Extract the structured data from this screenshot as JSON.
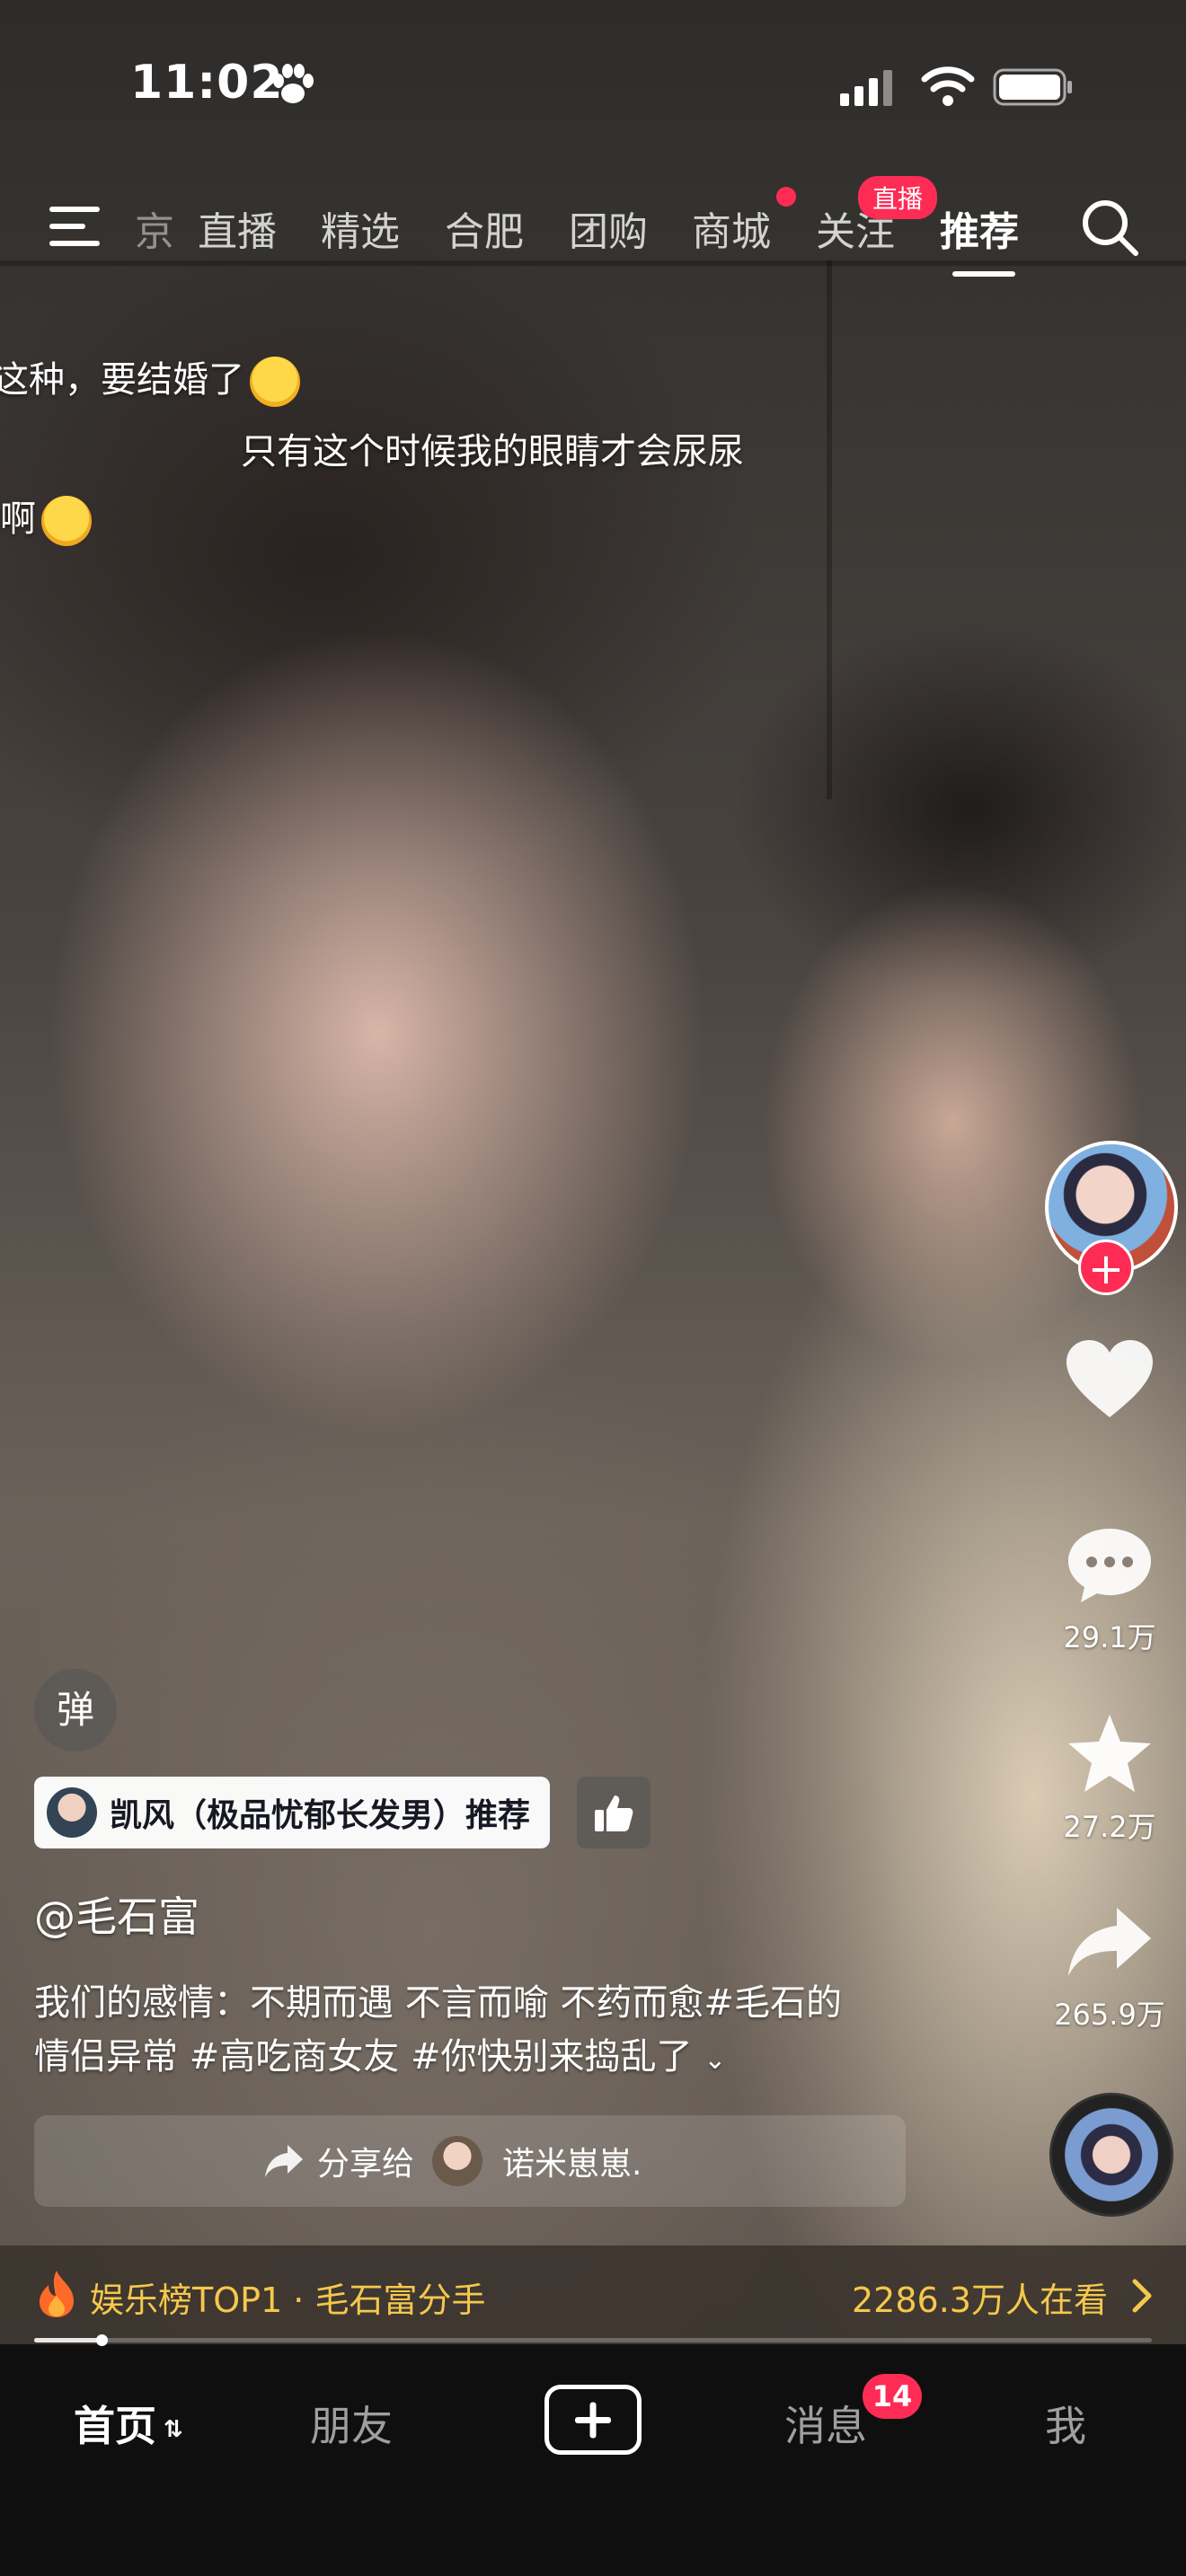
{
  "status_bar": {
    "time": "11:02"
  },
  "top_nav": {
    "tabs": [
      {
        "label": "京",
        "active": false
      },
      {
        "label": "直播",
        "active": false
      },
      {
        "label": "精选",
        "active": false
      },
      {
        "label": "合肥",
        "active": false
      },
      {
        "label": "团购",
        "active": false
      },
      {
        "label": "商城",
        "active": false,
        "has_dot": true
      },
      {
        "label": "关注",
        "active": false,
        "badge": "直播"
      },
      {
        "label": "推荐",
        "active": true
      }
    ]
  },
  "danmu": [
    "这种，要结婚了",
    "只有这个时候我的眼睛才会尿尿",
    "啊"
  ],
  "right_rail": {
    "likes": "",
    "comments": "29.1万",
    "favorites": "27.2万",
    "shares": "265.9万"
  },
  "danmu_toggle": "弹",
  "recommend": {
    "text": "凯风（极品忧郁长发男）推荐"
  },
  "author": "@毛石富",
  "caption": {
    "line1": "我们的感情：不期而遇 不言而喻 不药而愈#毛石的",
    "line2": "情侣异常 #高吃商女友 #你快别来捣乱了"
  },
  "share_bar": {
    "prefix": "分享给",
    "name": "诺米崽崽."
  },
  "hot_bar": {
    "left": "娱乐榜TOP1 · 毛石富分手",
    "right": "2286.3万人在看"
  },
  "progress": {
    "fraction": 0.06
  },
  "bottom_nav": {
    "home": "首页",
    "friends": "朋友",
    "messages": "消息",
    "messages_badge": "14",
    "me": "我"
  },
  "colors": {
    "accent": "#fe2c55",
    "hot": "#f5c84c"
  }
}
